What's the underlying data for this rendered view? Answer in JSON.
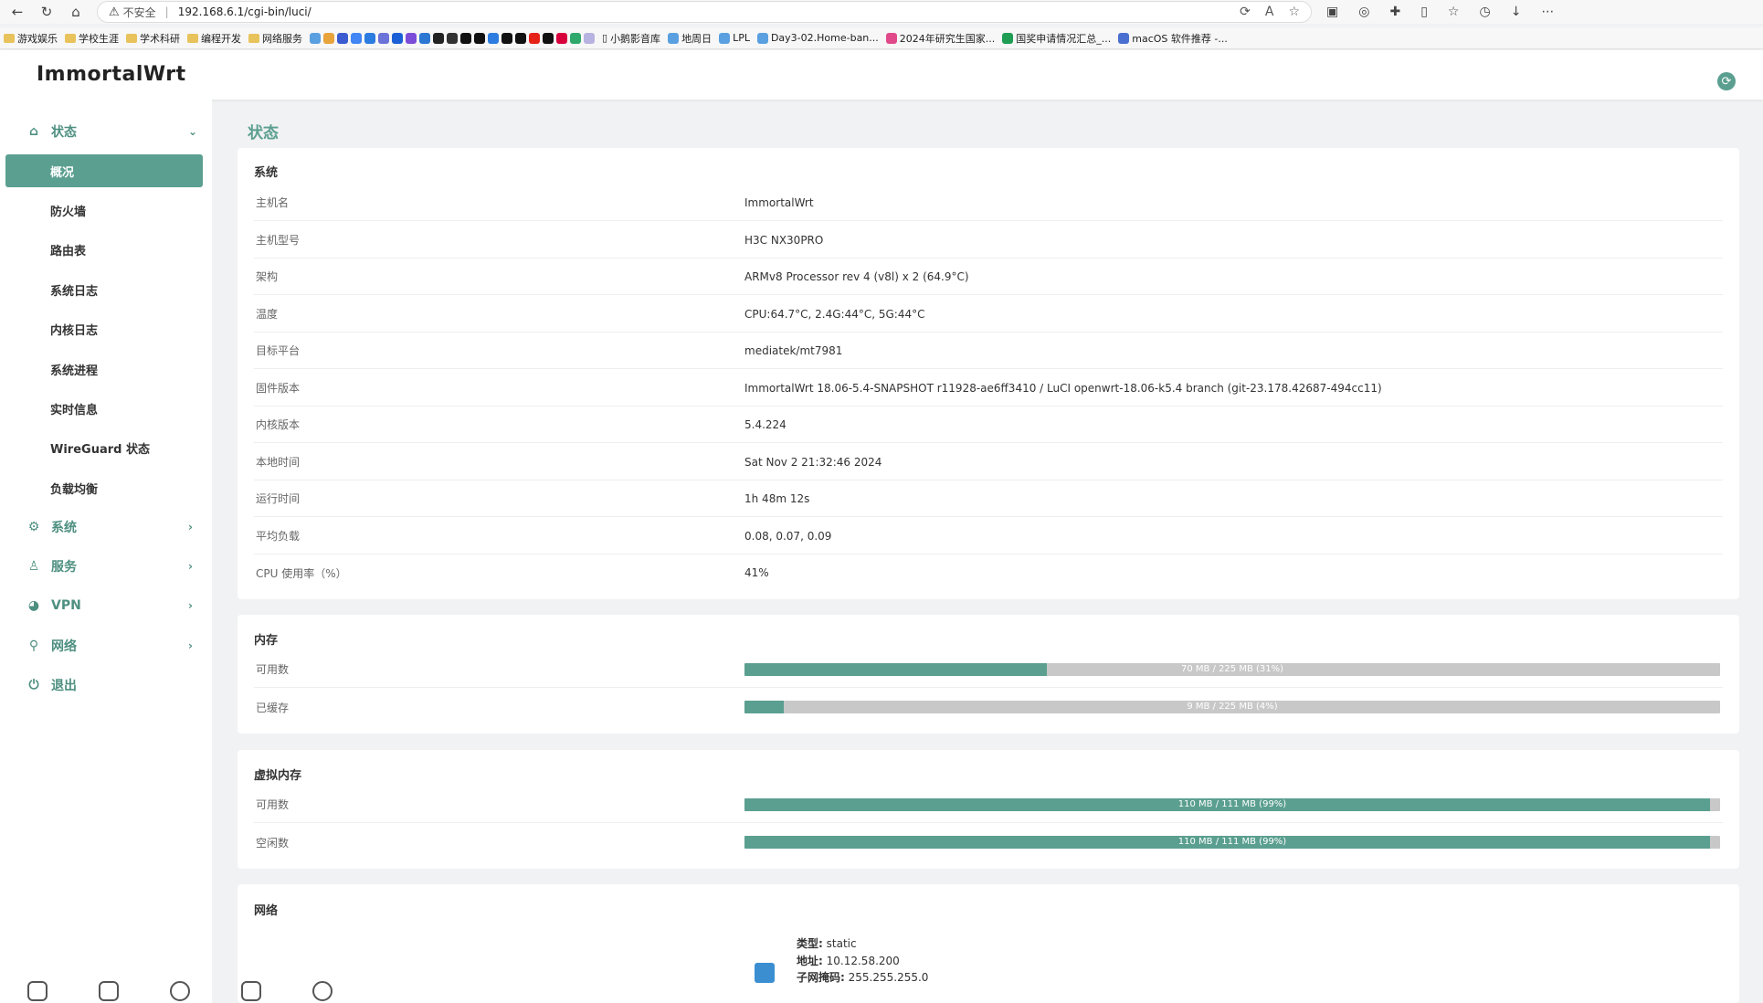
{
  "browser": {
    "insecure_label": "不安全",
    "separator": "|",
    "url": "192.168.6.1/cgi-bin/luci/",
    "bookmarks": [
      "游戏娱乐",
      "学校生涯",
      "学术科研",
      "编程开发",
      "网络服务",
      "小鹅影音库",
      "地周日",
      "LPL",
      "Day3-02.Home-ban...",
      "2024年研究生国家...",
      "国奖申请情况汇总_...",
      "macOS 软件推荐 -..."
    ]
  },
  "app": {
    "brand": "ImmortalWrt",
    "page_title": "状态"
  },
  "sidebar": {
    "status_label": "状态",
    "status_items": [
      "概况",
      "防火墙",
      "路由表",
      "系统日志",
      "内核日志",
      "系统进程",
      "实时信息",
      "WireGuard 状态",
      "负载均衡"
    ],
    "active_item": "概况",
    "system_label": "系统",
    "services_label": "服务",
    "vpn_label": "VPN",
    "network_label": "网络",
    "logout_label": "退出"
  },
  "system": {
    "title": "系统",
    "rows": [
      {
        "k": "主机名",
        "v": "ImmortalWrt"
      },
      {
        "k": "主机型号",
        "v": "H3C NX30PRO"
      },
      {
        "k": "架构",
        "v": "ARMv8 Processor rev 4 (v8l) x 2 (64.9°C)"
      },
      {
        "k": "温度",
        "v": "CPU:64.7°C, 2.4G:44°C, 5G:44°C"
      },
      {
        "k": "目标平台",
        "v": "mediatek/mt7981"
      },
      {
        "k": "固件版本",
        "v": "ImmortalWrt 18.06-5.4-SNAPSHOT r11928-ae6ff3410 / LuCI openwrt-18.06-k5.4 branch (git-23.178.42687-494cc11)"
      },
      {
        "k": "内核版本",
        "v": "5.4.224"
      },
      {
        "k": "本地时间",
        "v": "Sat Nov 2 21:32:46 2024"
      },
      {
        "k": "运行时间",
        "v": "1h 48m 12s"
      },
      {
        "k": "平均负载",
        "v": "0.08, 0.07, 0.09"
      },
      {
        "k": "CPU 使用率（%）",
        "v": "41%"
      }
    ]
  },
  "memory": {
    "title": "内存",
    "rows": [
      {
        "k": "可用数",
        "label": "70 MB / 225 MB (31%)",
        "fraction": 0.31
      },
      {
        "k": "已缓存",
        "label": "9 MB / 225 MB (4%)",
        "fraction": 0.04
      }
    ]
  },
  "swap": {
    "title": "虚拟内存",
    "rows": [
      {
        "k": "可用数",
        "label": "110 MB / 111 MB (99%)",
        "fraction": 0.99
      },
      {
        "k": "空闲数",
        "label": "110 MB / 111 MB (99%)",
        "fraction": 0.99
      }
    ]
  },
  "network": {
    "title": "网络",
    "type_key": "类型:",
    "type_val": "static",
    "addr_key": "地址:",
    "addr_val": "10.12.58.200",
    "mask_key": "子网掩码:",
    "mask_val": "255.255.255.0"
  },
  "colors": {
    "accent": "#5b9f90",
    "bar_bg": "#c8c8c8"
  }
}
